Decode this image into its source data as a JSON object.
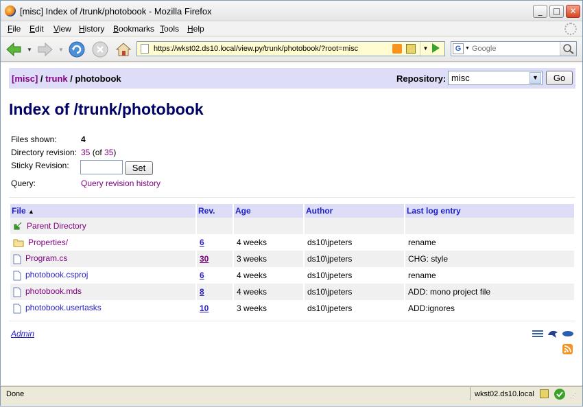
{
  "window": {
    "title": "[misc] Index of /trunk/photobook - Mozilla Firefox",
    "minimize": "_",
    "maximize": "□",
    "close": "✕"
  },
  "menu": [
    {
      "label": "File",
      "key": "F",
      "rest": "ile"
    },
    {
      "label": "Edit",
      "key": "E",
      "rest": "dit"
    },
    {
      "label": "View",
      "key": "V",
      "rest": "iew"
    },
    {
      "label": "History",
      "key": "H",
      "rest": "istory"
    },
    {
      "label": "Bookmarks",
      "key": "B",
      "rest": "ookmarks"
    },
    {
      "label": "Tools",
      "key": "T",
      "rest": "ools"
    },
    {
      "label": "Help",
      "key": "H",
      "rest": "elp"
    }
  ],
  "navbar": {
    "url": "https://wkst02.ds10.local/view.py/trunk/photobook/?root=misc",
    "search_placeholder": "Google",
    "search_engine_letter": "G"
  },
  "header": {
    "breadcrumb_root": "[misc]",
    "breadcrumb_sep1": " / ",
    "breadcrumb_trunk": "trunk",
    "breadcrumb_sep2": " / ",
    "breadcrumb_current": "photobook",
    "repository_label": "Repository:",
    "repository_value": "misc",
    "go_label": "Go"
  },
  "page_title": "Index of /trunk/photobook",
  "info": {
    "files_shown_label": "Files shown:",
    "files_shown_value": "4",
    "dir_rev_label": "Directory revision:",
    "dir_rev_value": "35",
    "dir_rev_of_prefix": " (of ",
    "dir_rev_of_value": "35",
    "dir_rev_of_suffix": ")",
    "sticky_label": "Sticky Revision:",
    "set_label": "Set",
    "query_label": "Query:",
    "query_link": "Query revision history"
  },
  "table": {
    "headers": {
      "file": "File",
      "sort_indicator": "▲",
      "rev": "Rev.",
      "age": "Age",
      "author": "Author",
      "log": "Last log entry"
    },
    "parent": "Parent Directory",
    "rows": [
      {
        "name": "Properties/",
        "rev": "6",
        "age": "4 weeks",
        "author": "ds10\\jpeters",
        "log": "rename",
        "type": "folder"
      },
      {
        "name": "Program.cs",
        "rev": "30",
        "age": "3 weeks",
        "author": "ds10\\jpeters",
        "log": "CHG: style",
        "type": "file"
      },
      {
        "name": "photobook.csproj",
        "rev": "6",
        "age": "4 weeks",
        "author": "ds10\\jpeters",
        "log": "rename",
        "type": "file"
      },
      {
        "name": "photobook.mds",
        "rev": "8",
        "age": "4 weeks",
        "author": "ds10\\jpeters",
        "log": "ADD: mono project file",
        "type": "file"
      },
      {
        "name": "photobook.usertasks",
        "rev": "10",
        "age": "3 weeks",
        "author": "ds10\\jpeters",
        "log": "ADD:ignores",
        "type": "file"
      }
    ]
  },
  "footer": {
    "admin_link": "Admin"
  },
  "status": {
    "text": "Done",
    "host": "wkst02.ds10.local"
  }
}
